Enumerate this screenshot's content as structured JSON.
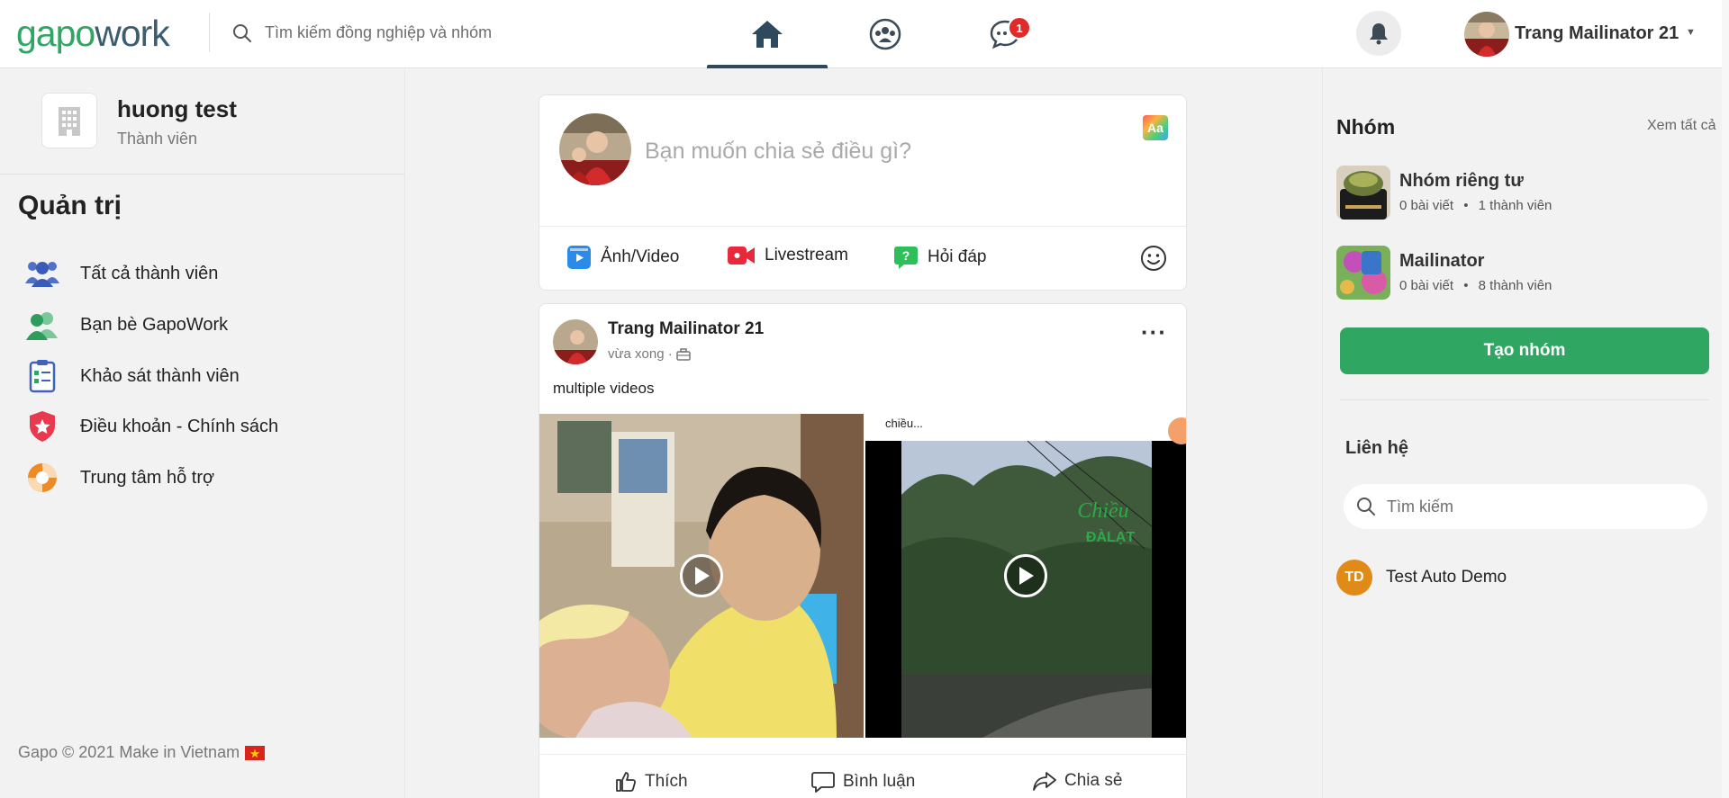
{
  "header": {
    "logo_gapo": "gapo",
    "logo_work": "work",
    "search_placeholder": "Tìm kiếm đồng nghiệp và nhóm",
    "nav_tabs": [
      {
        "name": "home",
        "icon": "home-icon",
        "active": true
      },
      {
        "name": "groups",
        "icon": "groups-icon",
        "active": false
      },
      {
        "name": "messages",
        "icon": "chat-icon",
        "active": false
      }
    ],
    "messages_badge": "1",
    "user_name": "Trang Mailinator 21"
  },
  "left_sidebar": {
    "org_name": "huong test",
    "org_role": "Thành viên",
    "section_title": "Quản trị",
    "menu": [
      {
        "label": "Tất cả thành viên",
        "icon": "members-icon"
      },
      {
        "label": "Bạn bè GapoWork",
        "icon": "friends-icon"
      },
      {
        "label": "Khảo sát thành viên",
        "icon": "survey-icon"
      },
      {
        "label": "Điều khoản - Chính sách",
        "icon": "policy-shield-icon"
      },
      {
        "label": "Trung tâm hỗ trợ",
        "icon": "lifebuoy-icon"
      }
    ],
    "footer": "Gapo © 2021 Make in Vietnam"
  },
  "composer": {
    "placeholder": "Bạn muốn chia sẻ điều gì?",
    "text_style_label": "Aa",
    "actions": [
      {
        "label": "Ảnh/Video",
        "icon": "photo-video-icon"
      },
      {
        "label": "Livestream",
        "icon": "livestream-icon"
      },
      {
        "label": "Hỏi đáp",
        "icon": "qa-icon"
      }
    ]
  },
  "post": {
    "author": "Trang Mailinator 21",
    "time": "vừa xong ·",
    "text": "multiple videos",
    "video_caption": "chiều...",
    "video_watermark_top": "Chiều",
    "video_watermark_bottom": "ĐÀLẠT",
    "actions": {
      "like": "Thích",
      "comment": "Bình luận",
      "share": "Chia sẻ"
    }
  },
  "right_sidebar": {
    "groups_title": "Nhóm",
    "see_all": "Xem tất cả",
    "groups": [
      {
        "name": "Nhóm riêng tư",
        "posts": "0 bài viết",
        "members": "1 thành viên"
      },
      {
        "name": "Mailinator",
        "posts": "0 bài viết",
        "members": "8 thành viên"
      }
    ],
    "create_group": "Tạo nhóm",
    "contacts_title": "Liên hệ",
    "contacts_search_placeholder": "Tìm kiếm",
    "contacts": [
      {
        "initials": "TD",
        "name": "Test Auto Demo"
      }
    ]
  }
}
